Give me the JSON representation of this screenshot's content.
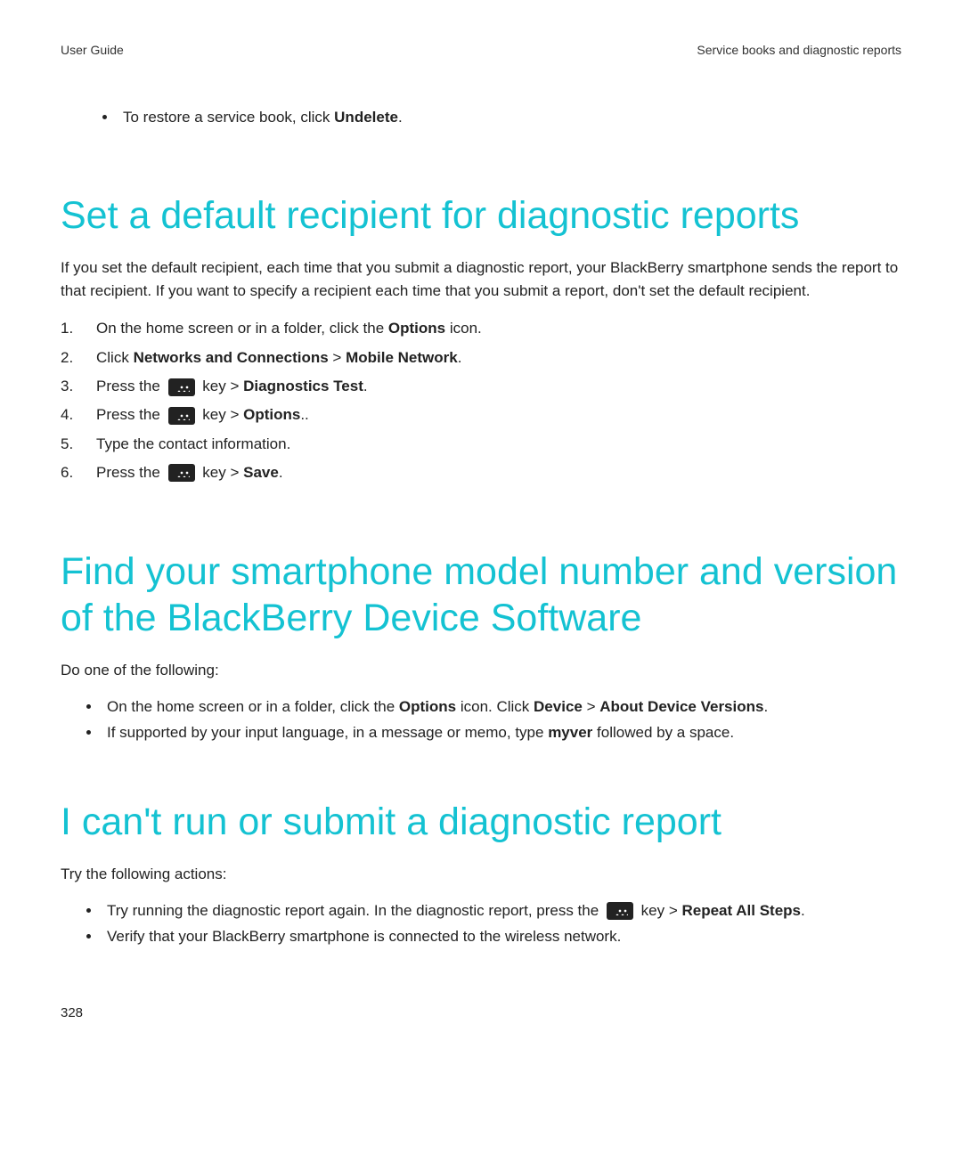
{
  "header": {
    "left": "User Guide",
    "right": "Service books and diagnostic reports"
  },
  "intro_bullet": {
    "prefix": "To restore a service book, click ",
    "bold": "Undelete",
    "suffix": "."
  },
  "section1": {
    "title": "Set a default recipient for diagnostic reports",
    "para": "If you set the default recipient, each time that you submit a diagnostic report, your BlackBerry smartphone sends the report to that recipient. If you want to specify a recipient each time that you submit a report, don't set the default recipient.",
    "step1": {
      "prefix": "On the home screen or in a folder, click the ",
      "b1": "Options",
      "suffix": " icon."
    },
    "step2": {
      "prefix": "Click ",
      "b1": "Networks and Connections",
      "mid": " > ",
      "b2": "Mobile Network",
      "suffix": "."
    },
    "step3": {
      "prefix": "Press the ",
      "mid": " key > ",
      "b1": "Diagnostics Test",
      "suffix": "."
    },
    "step4": {
      "prefix": "Press the ",
      "mid": " key > ",
      "b1": "Options",
      "suffix": ".."
    },
    "step5": {
      "text": "Type the contact information."
    },
    "step6": {
      "prefix": "Press the ",
      "mid": " key > ",
      "b1": "Save",
      "suffix": "."
    }
  },
  "section2": {
    "title": "Find your smartphone model number and version of the BlackBerry Device Software",
    "para": "Do one of the following:",
    "b1": {
      "prefix": "On the home screen or in a folder, click the ",
      "bold1": "Options",
      "mid1": " icon. Click ",
      "bold2": "Device",
      "mid2": " > ",
      "bold3": "About Device Versions",
      "suffix": "."
    },
    "b2": {
      "prefix": "If supported by your input language, in a message or memo, type ",
      "bold1": "myver",
      "suffix": " followed by a space."
    }
  },
  "section3": {
    "title": "I can't run or submit a diagnostic report",
    "para": "Try the following actions:",
    "b1": {
      "prefix": "Try running the diagnostic report again. In the diagnostic report, press the ",
      "mid": " key > ",
      "bold1": "Repeat All Steps",
      "suffix": "."
    },
    "b2": {
      "text": "Verify that your BlackBerry smartphone is connected to the wireless network."
    }
  },
  "page_number": "328"
}
